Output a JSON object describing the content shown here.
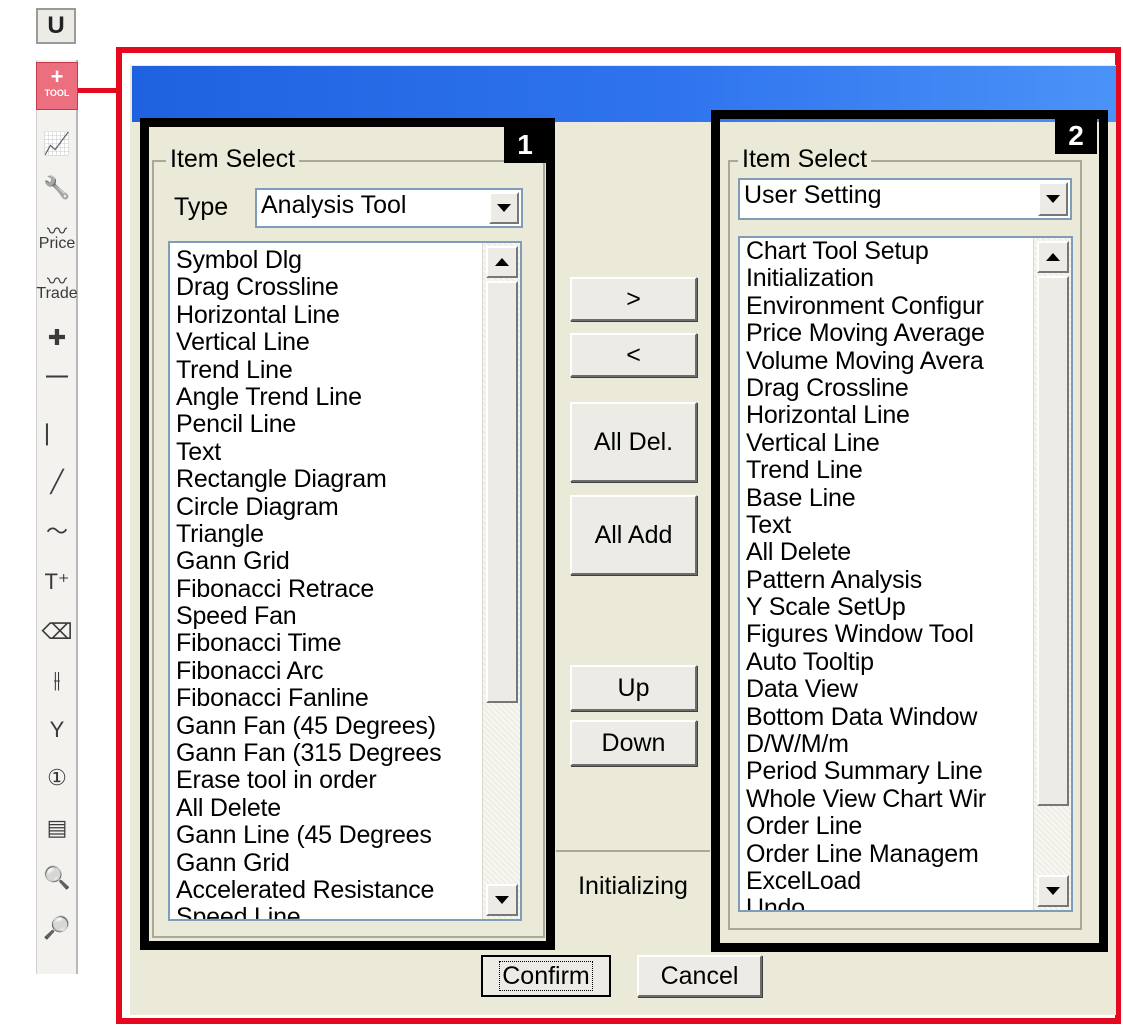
{
  "toolbar": {
    "top_button": "U",
    "active_tool": {
      "label": "TOOL",
      "icon": "plus-icon"
    },
    "tools": [
      {
        "name": "indicator-chart-icon",
        "glyph": "📈"
      },
      {
        "name": "wrench-icon",
        "glyph": "🔧"
      },
      {
        "name": "price-tool",
        "label": "Price"
      },
      {
        "name": "trade-tool",
        "label": "Trade"
      },
      {
        "name": "crossline-icon",
        "glyph": "✚"
      },
      {
        "name": "horizontal-line-icon",
        "glyph": "⎺"
      },
      {
        "name": "vertical-line-icon",
        "glyph": "⎸"
      },
      {
        "name": "trend-line-icon",
        "glyph": "╱"
      },
      {
        "name": "pencil-line-icon",
        "glyph": "〜"
      },
      {
        "name": "text-tool-icon",
        "glyph": "T⁺"
      },
      {
        "name": "all-delete-eraser-icon",
        "glyph": "⌫"
      },
      {
        "name": "candlestick-icon",
        "glyph": "⫲"
      },
      {
        "name": "y-scale-icon",
        "glyph": "Y"
      },
      {
        "name": "numbered-circle-icon",
        "glyph": "①"
      },
      {
        "name": "data-window-icon",
        "glyph": "▤"
      },
      {
        "name": "data-search-icon",
        "glyph": "🔍"
      },
      {
        "name": "chart-search-icon",
        "glyph": "🔎"
      }
    ]
  },
  "dialog": {
    "left_panel": {
      "badge": "1",
      "group_title": "Item Select",
      "type_label": "Type",
      "type_value": "Analysis Tool",
      "items": [
        "Symbol Dlg",
        "Drag Crossline",
        "Horizontal Line",
        "Vertical Line",
        "Trend Line",
        "Angle Trend Line",
        "Pencil Line",
        "Text",
        "Rectangle Diagram",
        "Circle Diagram",
        "Triangle",
        "Gann Grid",
        "Fibonacci Retrace",
        "Speed Fan",
        "Fibonacci Time",
        "Fibonacci Arc",
        "Fibonacci Fanline",
        "Gann Fan (45 Degrees)",
        "Gann Fan (315 Degrees",
        "Erase tool in order",
        "All Delete",
        "Gann Line (45 Degrees",
        "Gann Grid",
        "Accelerated Resistance",
        "Speed Line"
      ]
    },
    "middle": {
      "add": ">",
      "remove": "<",
      "all_del": "All Del.",
      "all_add": "All Add",
      "up": "Up",
      "down": "Down",
      "initializing": "Initializing"
    },
    "right_panel": {
      "badge": "2",
      "group_title": "Item Select",
      "select_value": "User Setting",
      "items": [
        "Chart Tool Setup",
        "Initialization",
        "Environment Configur",
        "Price Moving Average",
        "Volume Moving Avera",
        "Drag Crossline",
        "Horizontal Line",
        "Vertical Line",
        "Trend Line",
        "Base Line",
        "Text",
        "All Delete",
        "Pattern Analysis",
        "Y Scale SetUp",
        "Figures Window Tool",
        "Auto Tooltip",
        "Data View",
        "Bottom Data Window",
        "D/W/M/m",
        "Period Summary Line",
        "Whole View Chart Wir",
        "Order Line",
        "Order Line Managem",
        "ExcelLoad",
        "Undo"
      ]
    },
    "confirm": "Confirm",
    "cancel": "Cancel"
  },
  "colors": {
    "highlight_red": "#e5091f",
    "title_blue": "#2f74ee",
    "dialog_bg": "#ebe9d8",
    "active_tool_pink": "#ec6f7f"
  }
}
